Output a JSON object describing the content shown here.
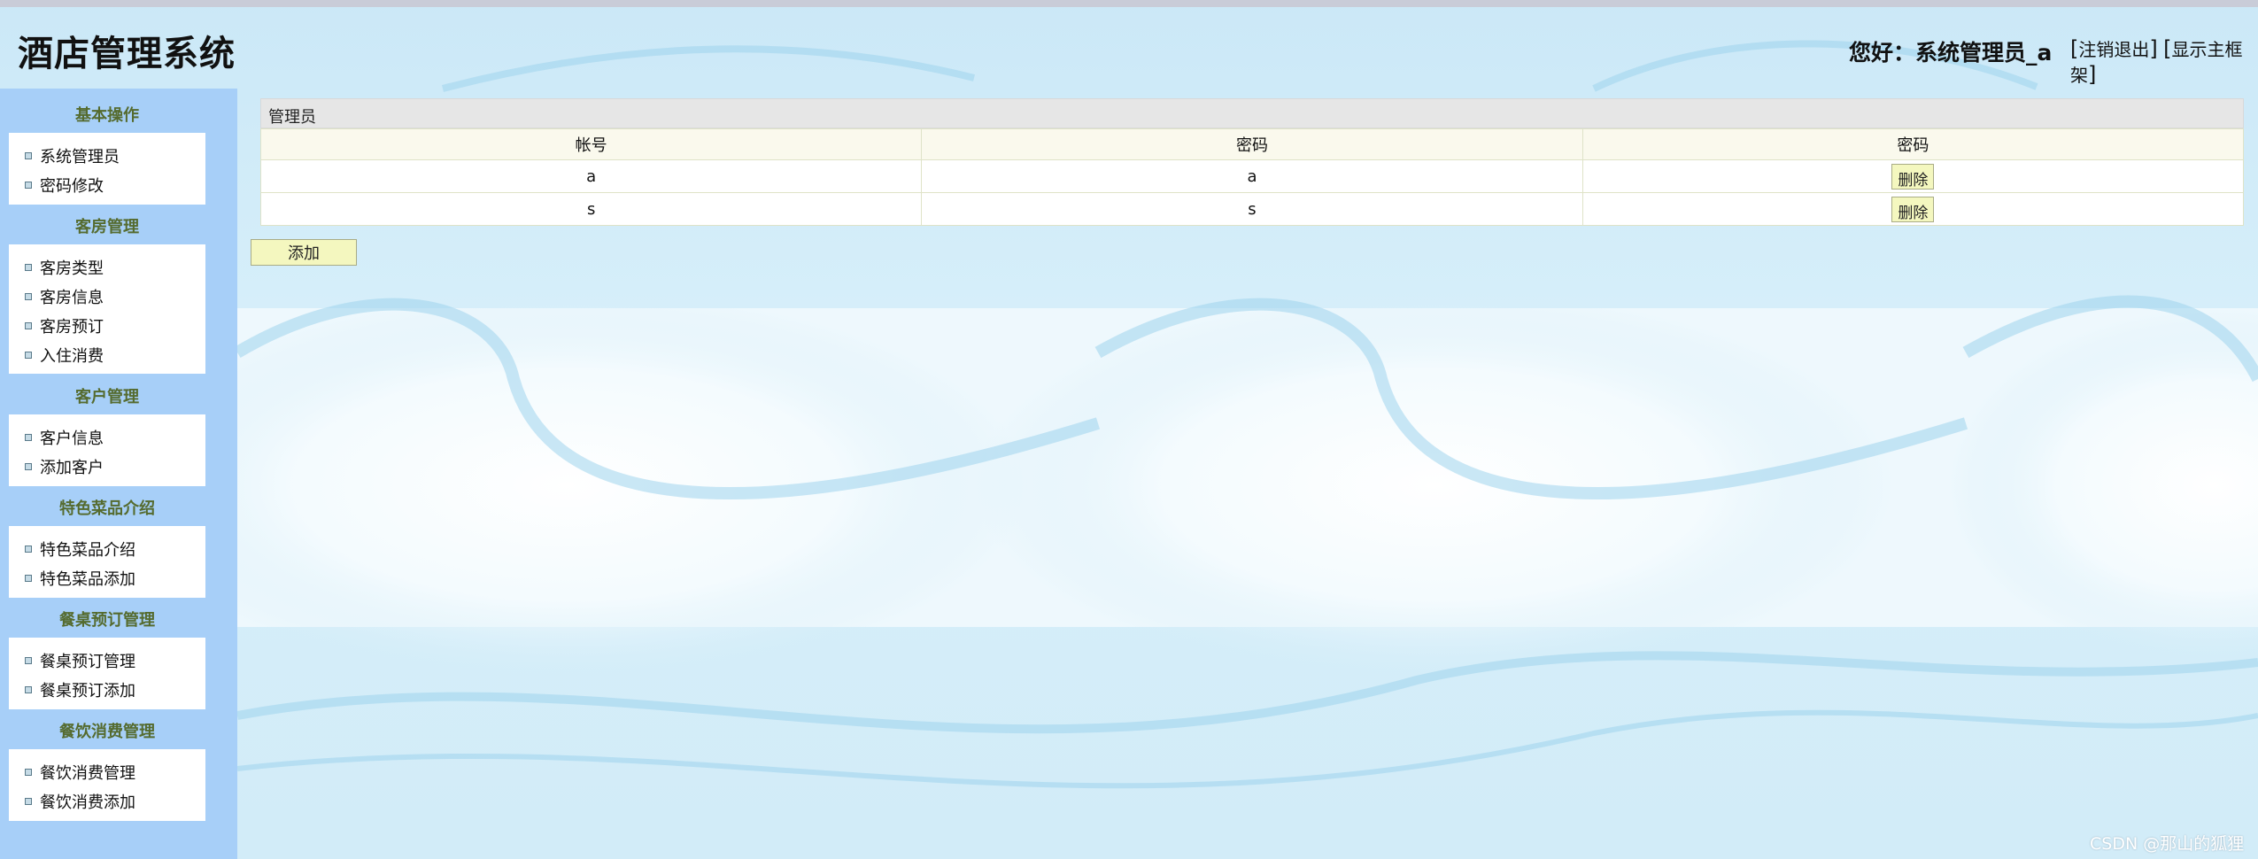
{
  "header": {
    "app_title": "酒店管理系统",
    "greeting": "您好：系统管理员_a",
    "logout_label": "注销退出",
    "show_frame_label": "显示主框架"
  },
  "sidebar": {
    "sections": [
      {
        "title": "基本操作",
        "items": [
          "系统管理员",
          "密码修改"
        ]
      },
      {
        "title": "客房管理",
        "items": [
          "客房类型",
          "客房信息",
          "客房预订",
          "入住消费"
        ]
      },
      {
        "title": "客户管理",
        "items": [
          "客户信息",
          "添加客户"
        ]
      },
      {
        "title": "特色菜品介绍",
        "items": [
          "特色菜品介绍",
          "特色菜品添加"
        ]
      },
      {
        "title": "餐桌预订管理",
        "items": [
          "餐桌预订管理",
          "餐桌预订添加"
        ]
      },
      {
        "title": "餐饮消费管理",
        "items": [
          "餐饮消费管理",
          "餐饮消费添加"
        ]
      }
    ]
  },
  "main": {
    "panel_title": "管理员",
    "columns": [
      "帐号",
      "密码",
      "密码"
    ],
    "rows": [
      {
        "account": "a",
        "password": "a",
        "action": "删除"
      },
      {
        "account": "s",
        "password": "s",
        "action": "删除"
      }
    ],
    "add_label": "添加"
  },
  "watermark": "CSDN @那山的狐狸",
  "colors": {
    "sidebar_bg": "#a7cff8",
    "section_title": "#556b2f",
    "button_bg": "#f4f7bf",
    "header_row_bg": "#faf9ed"
  }
}
